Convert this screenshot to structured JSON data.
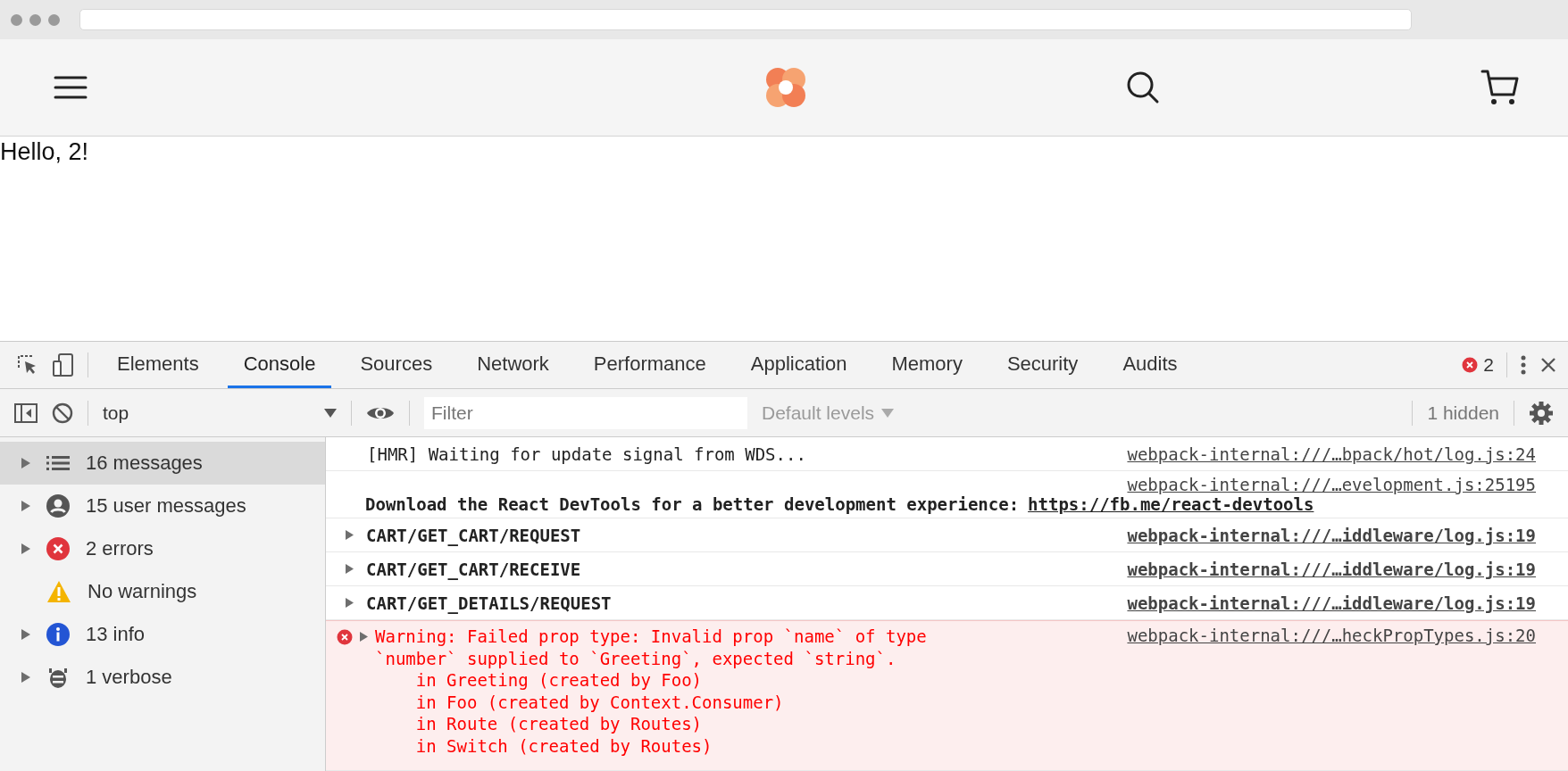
{
  "page": {
    "greeting": "Hello, 2!"
  },
  "devtools": {
    "tabs": [
      {
        "label": "Elements",
        "selected": false
      },
      {
        "label": "Console",
        "selected": true
      },
      {
        "label": "Sources",
        "selected": false
      },
      {
        "label": "Network",
        "selected": false
      },
      {
        "label": "Performance",
        "selected": false
      },
      {
        "label": "Application",
        "selected": false
      },
      {
        "label": "Memory",
        "selected": false
      },
      {
        "label": "Security",
        "selected": false
      },
      {
        "label": "Audits",
        "selected": false
      }
    ],
    "error_count": "2",
    "toolbar": {
      "context": "top",
      "filter_placeholder": "Filter",
      "levels": "Default levels",
      "hidden": "1 hidden"
    },
    "sidebar": [
      {
        "kind": "all",
        "label": "16 messages",
        "expandable": true,
        "selected": true
      },
      {
        "kind": "user",
        "label": "15 user messages",
        "expandable": true,
        "selected": false
      },
      {
        "kind": "error",
        "label": "2 errors",
        "expandable": true,
        "selected": false
      },
      {
        "kind": "warning",
        "label": "No warnings",
        "expandable": false,
        "selected": false
      },
      {
        "kind": "info",
        "label": "13 info",
        "expandable": true,
        "selected": false
      },
      {
        "kind": "verbose",
        "label": "1 verbose",
        "expandable": true,
        "selected": false
      }
    ],
    "messages": [
      {
        "kind": "log",
        "text": "[HMR] Waiting for update signal from WDS...",
        "source": "webpack-internal:///…bpack/hot/log.js:24"
      },
      {
        "kind": "notice",
        "text": "Download the React DevTools for a better development experience:",
        "link": "https://fb.me/react-devtools",
        "source": "webpack-internal:///…evelopment.js:25195"
      },
      {
        "kind": "group",
        "text": "CART/GET_CART/REQUEST",
        "source": "webpack-internal:///…iddleware/log.js:19"
      },
      {
        "kind": "group",
        "text": "CART/GET_CART/RECEIVE",
        "source": "webpack-internal:///…iddleware/log.js:19"
      },
      {
        "kind": "group",
        "text": "CART/GET_DETAILS/REQUEST",
        "source": "webpack-internal:///…iddleware/log.js:19"
      },
      {
        "kind": "error",
        "text": "Warning: Failed prop type: Invalid prop `name` of type\n`number` supplied to `Greeting`, expected `string`.\n    in Greeting (created by Foo)\n    in Foo (created by Context.Consumer)\n    in Route (created by Routes)\n    in Switch (created by Routes)",
        "source": "webpack-internal:///…heckPropTypes.js:20"
      }
    ]
  }
}
